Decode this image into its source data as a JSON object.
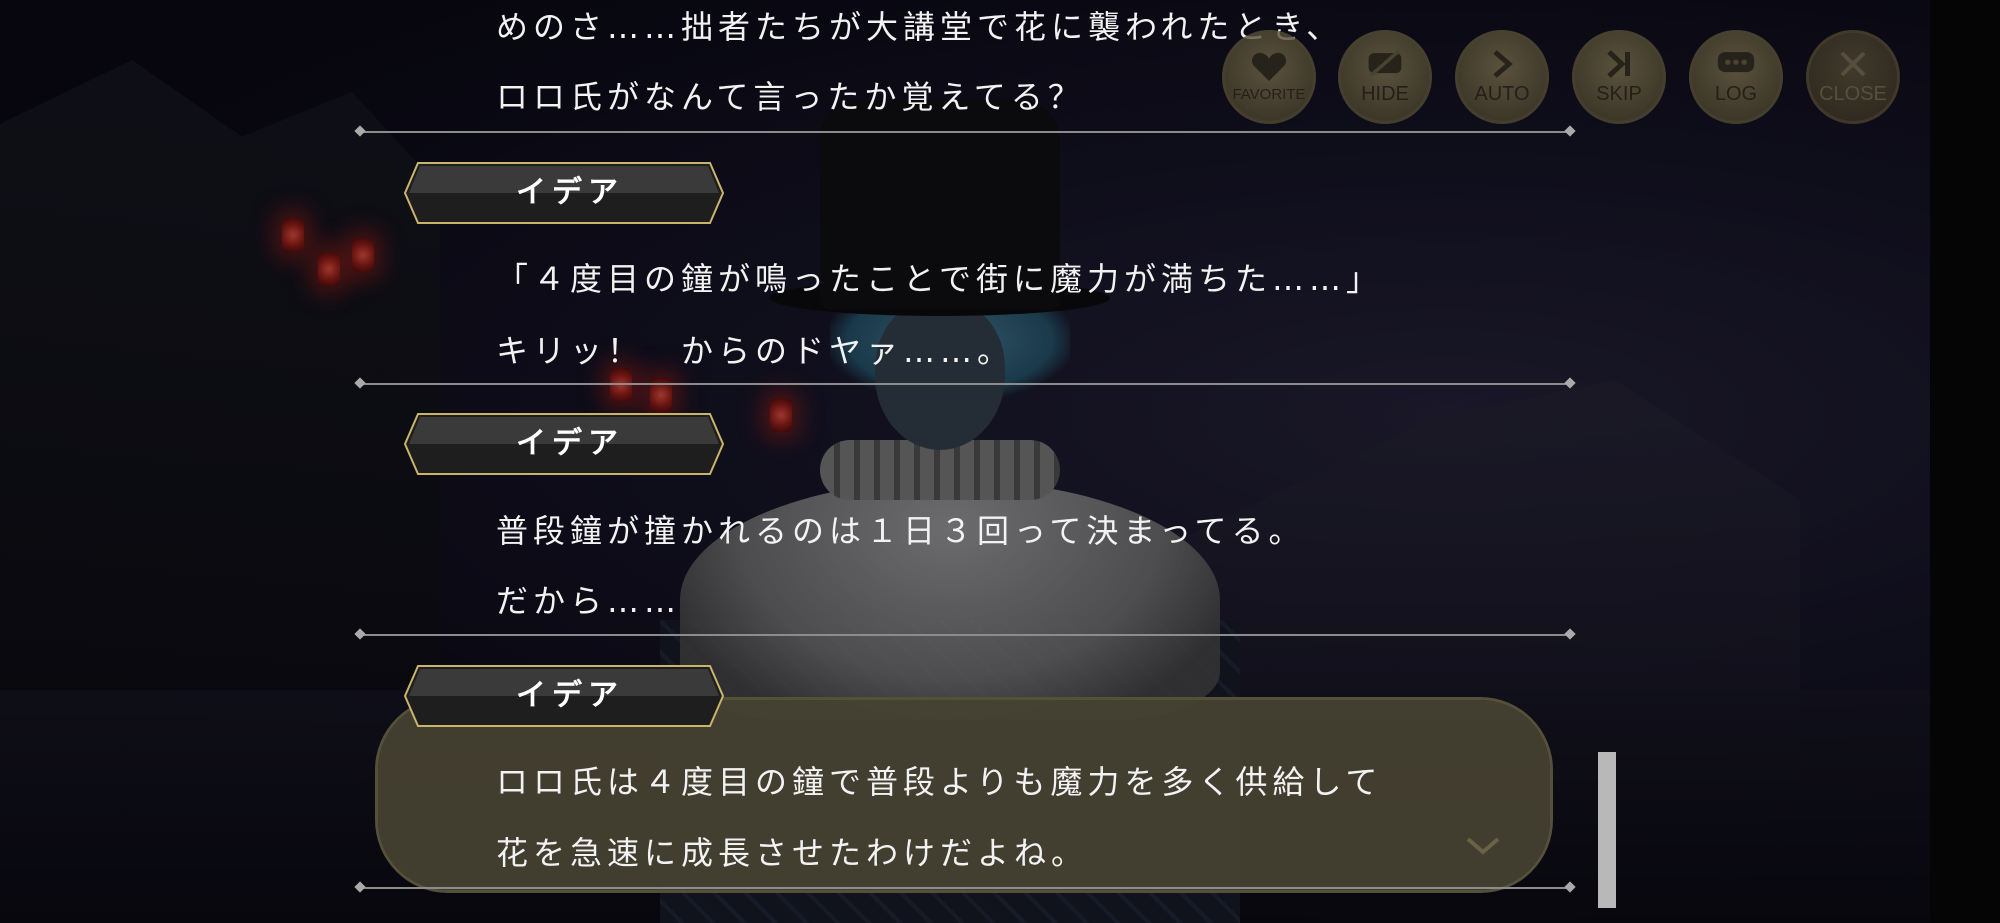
{
  "toolbar": {
    "favorite": "FAVORITE",
    "hide": "HIDE",
    "auto": "AUTO",
    "skip": "SKIP",
    "log": "LOG",
    "close": "CLOSE"
  },
  "log": {
    "entry0": {
      "line1": "めのさ……拙者たちが大講堂で花に襲われたとき、",
      "line2": "ロロ氏がなんて言ったか覚えてる？"
    },
    "entry1": {
      "speaker": "イデア",
      "line1": "「４度目の鐘が鳴ったことで街に魔力が満ちた……」",
      "line2": "キリッ！　からのドヤァ……。"
    },
    "entry2": {
      "speaker": "イデア",
      "line1": "普段鐘が撞かれるのは１日３回って決まってる。",
      "line2": "だから……"
    },
    "entry3": {
      "speaker": "イデア",
      "line1": "ロロ氏は４度目の鐘で普段よりも魔力を多く供給して",
      "line2": "花を急速に成長させたわけだよね。"
    }
  },
  "colors": {
    "button_bg": "#5a5238",
    "bubble_bg": "#46423a",
    "name_gold": "#c9b46a"
  },
  "icons": [
    "heart-icon",
    "hide-icon",
    "play-icon",
    "skip-icon",
    "speech-bubble-icon",
    "close-icon",
    "chevron-down-icon"
  ]
}
